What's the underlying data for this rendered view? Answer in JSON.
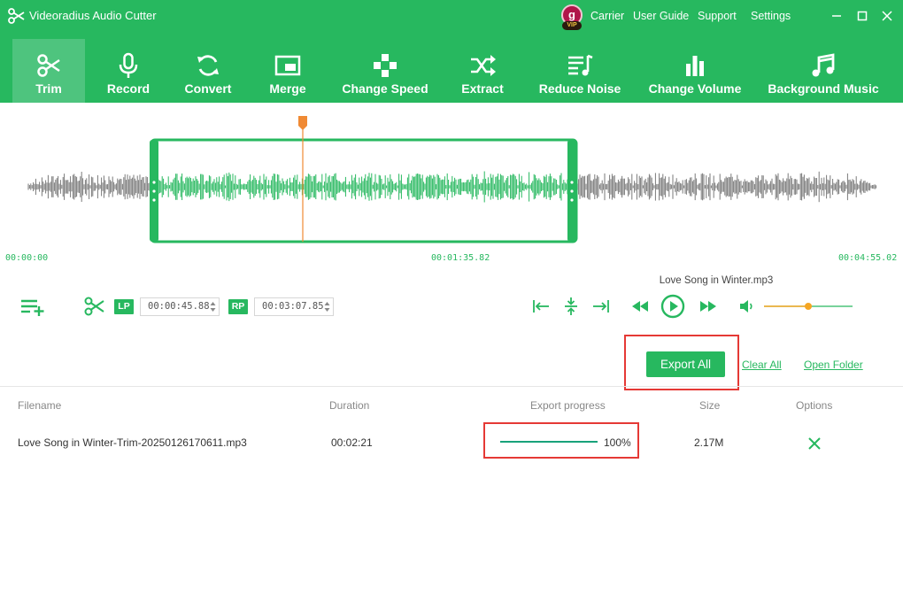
{
  "app": {
    "title": "Videoradius Audio Cutter",
    "vip_initial": "g",
    "vip_badge": "VIP"
  },
  "top_links": [
    {
      "label": "Carrier"
    },
    {
      "label": "User Guide"
    },
    {
      "label": "Support"
    },
    {
      "label": "Settings"
    }
  ],
  "toolbar": {
    "active": "Trim",
    "items": [
      {
        "label": "Trim",
        "icon": "scissors-icon"
      },
      {
        "label": "Record",
        "icon": "microphone-icon"
      },
      {
        "label": "Convert",
        "icon": "convert-arrows-icon"
      },
      {
        "label": "Merge",
        "icon": "merge-icon"
      },
      {
        "label": "Change Speed",
        "icon": "gamepad-icon"
      },
      {
        "label": "Extract",
        "icon": "shuffle-icon"
      },
      {
        "label": "Reduce Noise",
        "icon": "noise-icon"
      },
      {
        "label": "Change Volume",
        "icon": "volume-bars-icon"
      },
      {
        "label": "Background Music",
        "icon": "music-note-icon"
      }
    ]
  },
  "waveform": {
    "start_time": "00:00:00",
    "cursor_time": "00:01:35.82",
    "end_time": "00:04:55.02"
  },
  "controls": {
    "lp_label": "LP",
    "lp_value": "00:00:45.88",
    "rp_label": "RP",
    "rp_value": "00:03:07.85",
    "filename": "Love Song in Winter.mp3",
    "volume_level": 0.5
  },
  "export": {
    "export_all_label": "Export All",
    "clear_all_label": "Clear All",
    "open_folder_label": "Open Folder"
  },
  "table": {
    "columns": [
      "Filename",
      "Duration",
      "Export progress",
      "Size",
      "Options"
    ],
    "rows": [
      {
        "filename": "Love Song in Winter-Trim-20250126170611.mp3",
        "duration": "00:02:21",
        "progress_text": "100%",
        "progress": 1.0,
        "size": "2.17M"
      }
    ]
  },
  "colors": {
    "brand_green": "#27b85f",
    "highlight_red": "#e53935",
    "playhead_orange": "#f08a34",
    "wave_gray": "#7a7a7a"
  }
}
